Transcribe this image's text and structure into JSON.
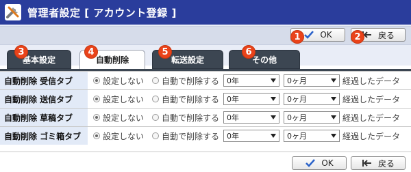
{
  "header": {
    "title": "管理者設定 [ アカウント登録 ]"
  },
  "buttons": {
    "ok": "OK",
    "back": "戻る"
  },
  "badges": [
    "1",
    "2",
    "3",
    "4",
    "5",
    "6"
  ],
  "tabs": [
    "基本設定",
    "自動削除",
    "転送設定",
    "その他"
  ],
  "rows": [
    {
      "label": "自動削除 受信タブ",
      "opt_none": "設定しない",
      "opt_auto": "自動で削除する",
      "year": "0年",
      "month": "0ヶ月",
      "suffix": "経過したデータ"
    },
    {
      "label": "自動削除 送信タブ",
      "opt_none": "設定しない",
      "opt_auto": "自動で削除する",
      "year": "0年",
      "month": "0ヶ月",
      "suffix": "経過したデータ"
    },
    {
      "label": "自動削除 草稿タブ",
      "opt_none": "設定しない",
      "opt_auto": "自動で削除する",
      "year": "0年",
      "month": "0ヶ月",
      "suffix": "経過したデータ"
    },
    {
      "label": "自動削除 ゴミ箱タブ",
      "opt_none": "設定しない",
      "opt_auto": "自動で削除する",
      "year": "0年",
      "month": "0ヶ月",
      "suffix": "経過したデータ"
    }
  ],
  "colors": {
    "title_bar": "#2a3d9c",
    "badge": "#e9431a",
    "tab_dark": "#3c4652",
    "label_bg": "#e2eaf7",
    "check": "#2a62c9"
  }
}
